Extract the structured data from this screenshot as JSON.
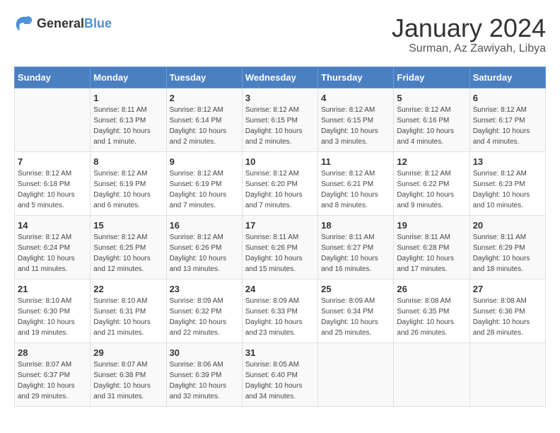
{
  "header": {
    "logo_general": "General",
    "logo_blue": "Blue",
    "month": "January 2024",
    "location": "Surman, Az Zawiyah, Libya"
  },
  "days_of_week": [
    "Sunday",
    "Monday",
    "Tuesday",
    "Wednesday",
    "Thursday",
    "Friday",
    "Saturday"
  ],
  "weeks": [
    [
      {
        "day": "",
        "sunrise": "",
        "sunset": "",
        "daylight": ""
      },
      {
        "day": "1",
        "sunrise": "Sunrise: 8:11 AM",
        "sunset": "Sunset: 6:13 PM",
        "daylight": "Daylight: 10 hours and 1 minute."
      },
      {
        "day": "2",
        "sunrise": "Sunrise: 8:12 AM",
        "sunset": "Sunset: 6:14 PM",
        "daylight": "Daylight: 10 hours and 2 minutes."
      },
      {
        "day": "3",
        "sunrise": "Sunrise: 8:12 AM",
        "sunset": "Sunset: 6:15 PM",
        "daylight": "Daylight: 10 hours and 2 minutes."
      },
      {
        "day": "4",
        "sunrise": "Sunrise: 8:12 AM",
        "sunset": "Sunset: 6:15 PM",
        "daylight": "Daylight: 10 hours and 3 minutes."
      },
      {
        "day": "5",
        "sunrise": "Sunrise: 8:12 AM",
        "sunset": "Sunset: 6:16 PM",
        "daylight": "Daylight: 10 hours and 4 minutes."
      },
      {
        "day": "6",
        "sunrise": "Sunrise: 8:12 AM",
        "sunset": "Sunset: 6:17 PM",
        "daylight": "Daylight: 10 hours and 4 minutes."
      }
    ],
    [
      {
        "day": "7",
        "sunrise": "Sunrise: 8:12 AM",
        "sunset": "Sunset: 6:18 PM",
        "daylight": "Daylight: 10 hours and 5 minutes."
      },
      {
        "day": "8",
        "sunrise": "Sunrise: 8:12 AM",
        "sunset": "Sunset: 6:19 PM",
        "daylight": "Daylight: 10 hours and 6 minutes."
      },
      {
        "day": "9",
        "sunrise": "Sunrise: 8:12 AM",
        "sunset": "Sunset: 6:19 PM",
        "daylight": "Daylight: 10 hours and 7 minutes."
      },
      {
        "day": "10",
        "sunrise": "Sunrise: 8:12 AM",
        "sunset": "Sunset: 6:20 PM",
        "daylight": "Daylight: 10 hours and 7 minutes."
      },
      {
        "day": "11",
        "sunrise": "Sunrise: 8:12 AM",
        "sunset": "Sunset: 6:21 PM",
        "daylight": "Daylight: 10 hours and 8 minutes."
      },
      {
        "day": "12",
        "sunrise": "Sunrise: 8:12 AM",
        "sunset": "Sunset: 6:22 PM",
        "daylight": "Daylight: 10 hours and 9 minutes."
      },
      {
        "day": "13",
        "sunrise": "Sunrise: 8:12 AM",
        "sunset": "Sunset: 6:23 PM",
        "daylight": "Daylight: 10 hours and 10 minutes."
      }
    ],
    [
      {
        "day": "14",
        "sunrise": "Sunrise: 8:12 AM",
        "sunset": "Sunset: 6:24 PM",
        "daylight": "Daylight: 10 hours and 11 minutes."
      },
      {
        "day": "15",
        "sunrise": "Sunrise: 8:12 AM",
        "sunset": "Sunset: 6:25 PM",
        "daylight": "Daylight: 10 hours and 12 minutes."
      },
      {
        "day": "16",
        "sunrise": "Sunrise: 8:12 AM",
        "sunset": "Sunset: 6:26 PM",
        "daylight": "Daylight: 10 hours and 13 minutes."
      },
      {
        "day": "17",
        "sunrise": "Sunrise: 8:11 AM",
        "sunset": "Sunset: 6:26 PM",
        "daylight": "Daylight: 10 hours and 15 minutes."
      },
      {
        "day": "18",
        "sunrise": "Sunrise: 8:11 AM",
        "sunset": "Sunset: 6:27 PM",
        "daylight": "Daylight: 10 hours and 16 minutes."
      },
      {
        "day": "19",
        "sunrise": "Sunrise: 8:11 AM",
        "sunset": "Sunset: 6:28 PM",
        "daylight": "Daylight: 10 hours and 17 minutes."
      },
      {
        "day": "20",
        "sunrise": "Sunrise: 8:11 AM",
        "sunset": "Sunset: 6:29 PM",
        "daylight": "Daylight: 10 hours and 18 minutes."
      }
    ],
    [
      {
        "day": "21",
        "sunrise": "Sunrise: 8:10 AM",
        "sunset": "Sunset: 6:30 PM",
        "daylight": "Daylight: 10 hours and 19 minutes."
      },
      {
        "day": "22",
        "sunrise": "Sunrise: 8:10 AM",
        "sunset": "Sunset: 6:31 PM",
        "daylight": "Daylight: 10 hours and 21 minutes."
      },
      {
        "day": "23",
        "sunrise": "Sunrise: 8:09 AM",
        "sunset": "Sunset: 6:32 PM",
        "daylight": "Daylight: 10 hours and 22 minutes."
      },
      {
        "day": "24",
        "sunrise": "Sunrise: 8:09 AM",
        "sunset": "Sunset: 6:33 PM",
        "daylight": "Daylight: 10 hours and 23 minutes."
      },
      {
        "day": "25",
        "sunrise": "Sunrise: 8:09 AM",
        "sunset": "Sunset: 6:34 PM",
        "daylight": "Daylight: 10 hours and 25 minutes."
      },
      {
        "day": "26",
        "sunrise": "Sunrise: 8:08 AM",
        "sunset": "Sunset: 6:35 PM",
        "daylight": "Daylight: 10 hours and 26 minutes."
      },
      {
        "day": "27",
        "sunrise": "Sunrise: 8:08 AM",
        "sunset": "Sunset: 6:36 PM",
        "daylight": "Daylight: 10 hours and 28 minutes."
      }
    ],
    [
      {
        "day": "28",
        "sunrise": "Sunrise: 8:07 AM",
        "sunset": "Sunset: 6:37 PM",
        "daylight": "Daylight: 10 hours and 29 minutes."
      },
      {
        "day": "29",
        "sunrise": "Sunrise: 8:07 AM",
        "sunset": "Sunset: 6:38 PM",
        "daylight": "Daylight: 10 hours and 31 minutes."
      },
      {
        "day": "30",
        "sunrise": "Sunrise: 8:06 AM",
        "sunset": "Sunset: 6:39 PM",
        "daylight": "Daylight: 10 hours and 32 minutes."
      },
      {
        "day": "31",
        "sunrise": "Sunrise: 8:05 AM",
        "sunset": "Sunset: 6:40 PM",
        "daylight": "Daylight: 10 hours and 34 minutes."
      },
      {
        "day": "",
        "sunrise": "",
        "sunset": "",
        "daylight": ""
      },
      {
        "day": "",
        "sunrise": "",
        "sunset": "",
        "daylight": ""
      },
      {
        "day": "",
        "sunrise": "",
        "sunset": "",
        "daylight": ""
      }
    ]
  ]
}
